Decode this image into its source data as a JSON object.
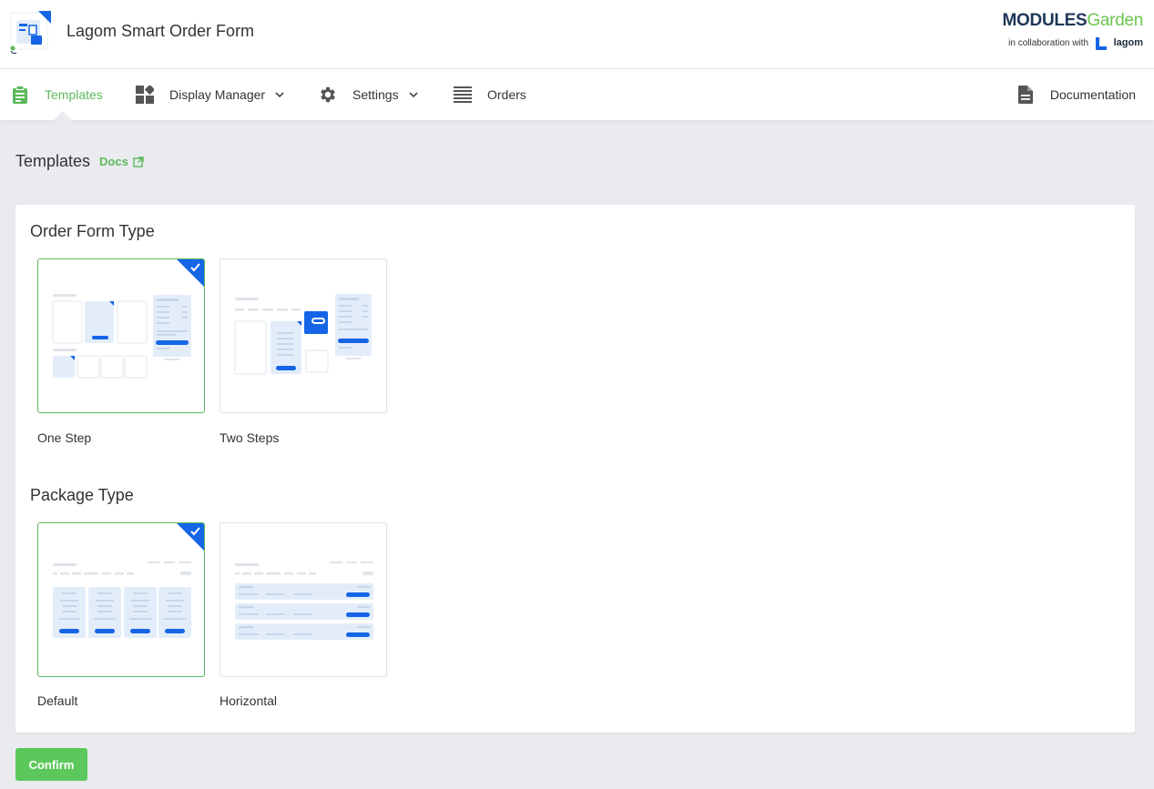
{
  "header": {
    "app_title": "Lagom Smart Order Form",
    "brand_modules": "MODULES",
    "brand_garden": "Garden",
    "brand_collab": "in collaboration with",
    "brand_lagom": "lagom"
  },
  "nav": {
    "items": [
      {
        "label": "Templates",
        "icon": "clipboard-icon",
        "active": true
      },
      {
        "label": "Display Manager",
        "icon": "dashboard-icon",
        "dropdown": true
      },
      {
        "label": "Settings",
        "icon": "gear-icon",
        "dropdown": true
      },
      {
        "label": "Orders",
        "icon": "list-icon"
      }
    ],
    "right_item": {
      "label": "Documentation",
      "icon": "document-icon"
    }
  },
  "page": {
    "title": "Templates",
    "docs_label": "Docs"
  },
  "sections": {
    "order_form_type": {
      "title": "Order Form Type",
      "options": [
        {
          "label": "One Step",
          "selected": true
        },
        {
          "label": "Two Steps",
          "selected": false
        }
      ]
    },
    "package_type": {
      "title": "Package Type",
      "options": [
        {
          "label": "Default",
          "selected": true
        },
        {
          "label": "Horizontal",
          "selected": false
        }
      ]
    }
  },
  "actions": {
    "confirm_label": "Confirm"
  },
  "colors": {
    "accent_green": "#5cb85c",
    "selected_blue": "#1565e6",
    "light_blue": "#e3edfa"
  }
}
